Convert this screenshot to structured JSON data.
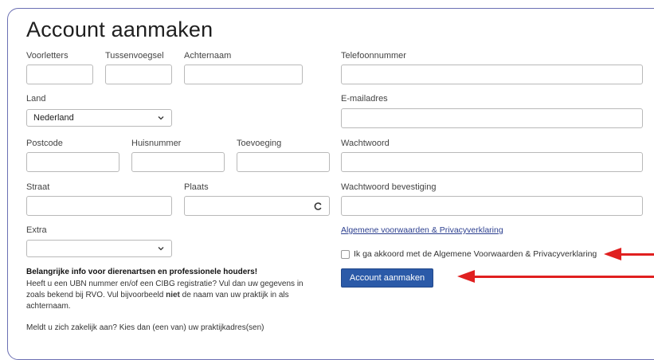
{
  "form": {
    "title": "Account aanmaken",
    "voorletters_label": "Voorletters",
    "tussenvoegsel_label": "Tussenvoegsel",
    "achternaam_label": "Achternaam",
    "telefoon_label": "Telefoonnummer",
    "land_label": "Land",
    "land_value": "Nederland",
    "email_label": "E-mailadres",
    "postcode_label": "Postcode",
    "huisnummer_label": "Huisnummer",
    "toevoeging_label": "Toevoeging",
    "wachtwoord_label": "Wachtwoord",
    "straat_label": "Straat",
    "plaats_label": "Plaats",
    "wachtwoord_bevestiging_label": "Wachtwoord bevestiging",
    "extra_label": "Extra",
    "extra_value": "",
    "terms_link": "Algemene voorwaarden & Privacyverklaring",
    "agree_label": "Ik ga akkoord met de Algemene Voorwaarden & Privacyverklaring",
    "agree_checked": false,
    "submit_label": "Account aanmaken"
  },
  "info": {
    "title": "Belangrijke info voor dierenartsen en professionele houders!",
    "line1": "Heeft u een UBN nummer en/of een CIBG registratie? Vul dan uw gegevens in",
    "line2_pre": "zoals bekend bij RVO. Vul bijvoorbeeld ",
    "line2_bold": "niet",
    "line2_post": " de naam van uw praktijk in als",
    "line3": "achternaam.",
    "business": "Meldt u zich zakelijk aan? Kies dan (een van) uw praktijkadres(sen)"
  },
  "colors": {
    "border": "#6b6fb3",
    "button": "#2b5aa8",
    "link": "#2c3f8f",
    "arrow": "#e02020"
  }
}
